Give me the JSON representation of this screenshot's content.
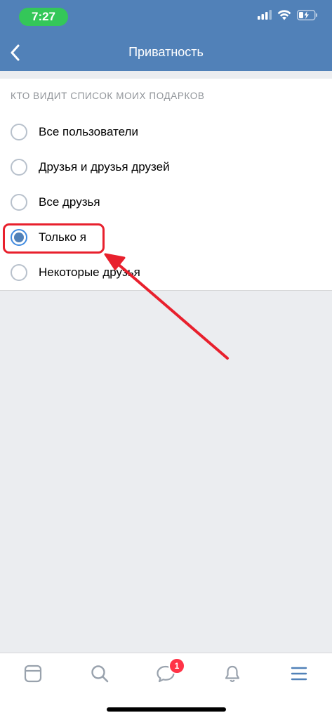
{
  "status_bar": {
    "time": "7:27"
  },
  "header": {
    "title": "Приватность"
  },
  "privacy": {
    "section_title": "КТО ВИДИТ СПИСОК МОИХ ПОДАРКОВ",
    "options": [
      {
        "label": "Все пользователи",
        "selected": false
      },
      {
        "label": "Друзья и друзья друзей",
        "selected": false
      },
      {
        "label": "Все друзья",
        "selected": false
      },
      {
        "label": "Только я",
        "selected": true
      },
      {
        "label": "Некоторые друзья",
        "selected": false
      }
    ]
  },
  "tabbar": {
    "tabs": [
      "newsfeed-icon",
      "search-icon",
      "messages-icon",
      "notifications-icon",
      "menu-icon"
    ],
    "messages_badge": "1"
  },
  "colors": {
    "header": "#5181b8",
    "accent": "#3f8ae0",
    "annotation": "#e8202d",
    "background": "#ebedf0",
    "badge": "#ff3347"
  }
}
